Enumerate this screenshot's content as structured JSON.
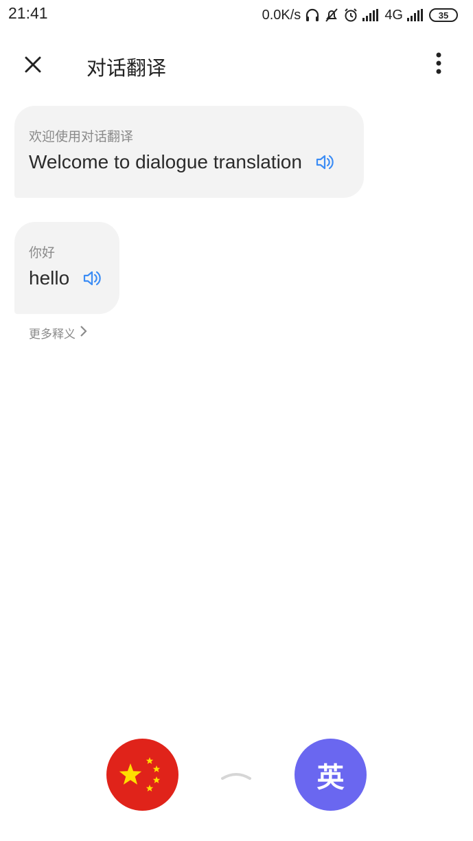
{
  "status": {
    "time": "21:41",
    "speed": "0.0K/s",
    "network": "4G",
    "battery": "35",
    "icons": [
      "headphones-icon",
      "notifications-off-icon",
      "alarm-icon",
      "signal-icon",
      "signal-icon"
    ]
  },
  "header": {
    "title": "对话翻译",
    "close_icon": "close-icon",
    "menu_icon": "more-vert-icon"
  },
  "messages": [
    {
      "source": "欢迎使用对话翻译",
      "target": "Welcome to dialogue translation"
    },
    {
      "source": "你好",
      "target": "hello"
    }
  ],
  "more_meanings": "更多释义",
  "languages": {
    "left_icon": "china-flag-icon",
    "right_label": "英"
  },
  "colors": {
    "bubble_bg": "#f3f3f3",
    "speaker_blue": "#3b8cf5",
    "china_red": "#e0231a",
    "english_purple": "#6a67f0"
  }
}
